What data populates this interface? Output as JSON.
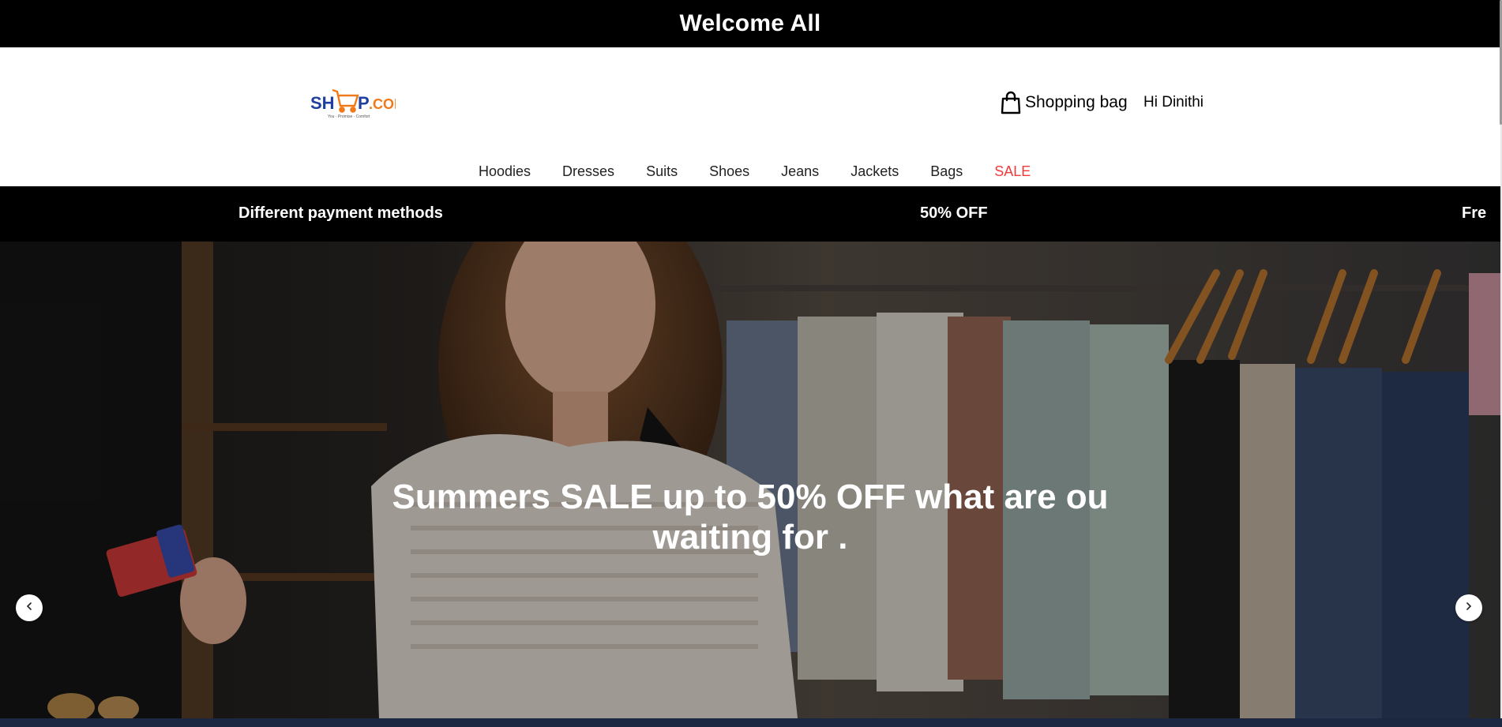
{
  "welcome_banner": {
    "text": "Welcome All"
  },
  "header": {
    "logo": {
      "text": "SHOP.COM",
      "tagline": "You · Promise · Comfort"
    },
    "shopping_bag_label": "Shopping bag",
    "greeting": "Hi Dinithi",
    "icons": {
      "bag": "shopping-bag-icon"
    }
  },
  "nav": {
    "items": [
      {
        "label": "Hoodies"
      },
      {
        "label": "Dresses"
      },
      {
        "label": "Suits"
      },
      {
        "label": "Shoes"
      },
      {
        "label": "Jeans"
      },
      {
        "label": "Jackets"
      },
      {
        "label": "Bags"
      },
      {
        "label": "SALE"
      }
    ]
  },
  "promo_strip": {
    "items": [
      {
        "text": "Different payment methods"
      },
      {
        "text": "50% OFF"
      },
      {
        "text": "Fre"
      }
    ]
  },
  "hero": {
    "caption": "Summers SALE up to 50% OFF what are ou waiting for .",
    "prev_icon": "chevron-left-icon",
    "next_icon": "chevron-right-icon"
  },
  "colors": {
    "sale": "#ef3b3b",
    "logo_blue": "#1f3fa0",
    "logo_orange": "#f07a1a",
    "banner_bg": "#000000"
  }
}
